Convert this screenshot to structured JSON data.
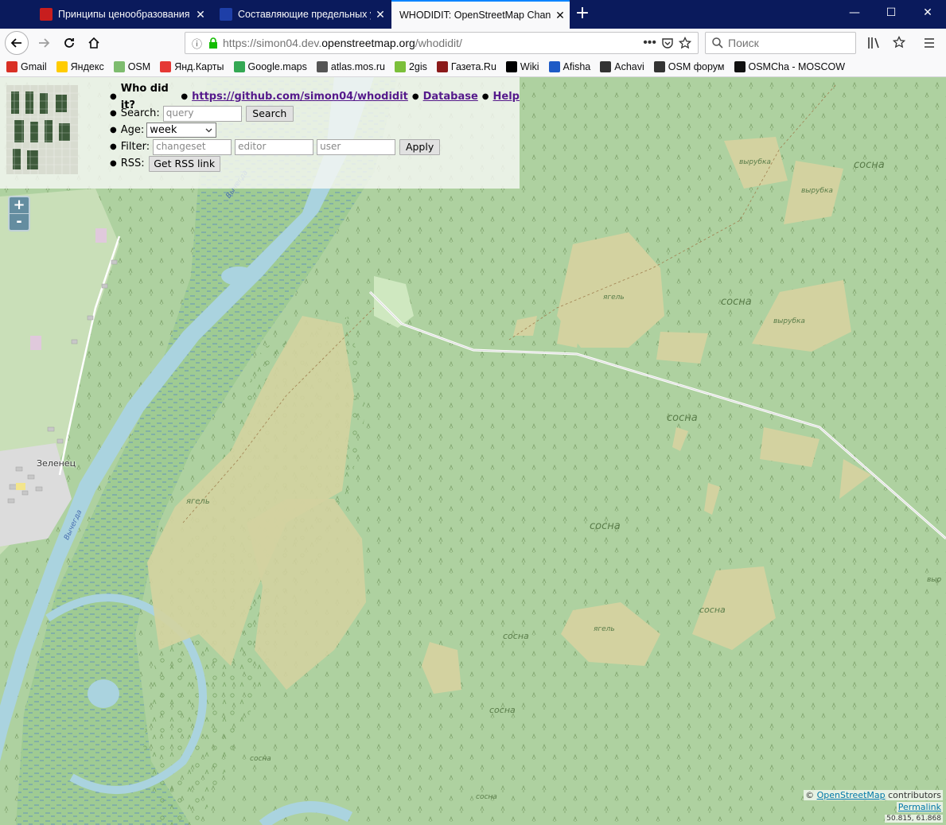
{
  "browser": {
    "tabs": [
      {
        "title": "Принципы ценообразования",
        "icon_color": "#c81e1e",
        "active": false
      },
      {
        "title": "Составляющие предельных у",
        "icon_color": "#1e3fa8",
        "active": false
      },
      {
        "title": "WHODIDIT: OpenStreetMap Chang",
        "icon_color": "#f9f9fa",
        "active": true
      }
    ],
    "new_tab_label": "+",
    "window_controls": {
      "minimize": "—",
      "maximize": "☐",
      "close": "✕"
    },
    "url": {
      "prefix": "https://simon04.dev.",
      "host": "openstreetmap.org",
      "path": "/whodidit/"
    },
    "search_placeholder": "Поиск",
    "bookmarks": [
      {
        "label": "Gmail",
        "icon": "gmail-icon",
        "color": "#d93025"
      },
      {
        "label": "Яндекс",
        "icon": "yandex-icon",
        "color": "#ffcc00"
      },
      {
        "label": "OSM",
        "icon": "osm-icon",
        "color": "#7ebc6f"
      },
      {
        "label": "Янд.Карты",
        "icon": "pin-icon",
        "color": "#e53935"
      },
      {
        "label": "Google.maps",
        "icon": "google-maps-icon",
        "color": "#34a853"
      },
      {
        "label": "atlas.mos.ru",
        "icon": "atlas-icon",
        "color": "#555555"
      },
      {
        "label": "2gis",
        "icon": "2gis-icon",
        "color": "#7bbf3a"
      },
      {
        "label": "Газета.Ru",
        "icon": "gazeta-icon",
        "color": "#8b1a1a"
      },
      {
        "label": "Wiki",
        "icon": "wiki-icon",
        "color": "#000000"
      },
      {
        "label": "Afisha",
        "icon": "afisha-icon",
        "color": "#1e5bc6"
      },
      {
        "label": "Achavi",
        "icon": "globe-icon",
        "color": "#333333"
      },
      {
        "label": "OSM форум",
        "icon": "globe-icon",
        "color": "#333333"
      },
      {
        "label": "OSMCha - MOSCOW",
        "icon": "osmcha-icon",
        "color": "#111111"
      }
    ]
  },
  "whodidit": {
    "title": "Who did it?",
    "links": [
      "https://github.com/simon04/whodidit",
      "Database",
      "Help"
    ],
    "search_label": "Search:",
    "search_placeholder": "query",
    "search_button": "Search",
    "age_label": "Age:",
    "age_value": "week",
    "filter_label": "Filter:",
    "filter_placeholders": [
      "changeset",
      "editor",
      "user"
    ],
    "apply_button": "Apply",
    "rss_label": "RSS:",
    "rss_button": "Get RSS link"
  },
  "map": {
    "zoom_in": "+",
    "zoom_out": "-",
    "labels": {
      "town": "Зеленец",
      "river_1": "Вычегда",
      "river_2": "Вычегда",
      "sosna": "сосна",
      "yagel": "ягель",
      "vyrubka": "вырубка",
      "vyr_edge": "выр"
    },
    "attribution": {
      "prefix": "© ",
      "link": "OpenStreetMap",
      "suffix": " contributors"
    },
    "permalink": "Permalink",
    "coords": "50.815, 61.868",
    "colors": {
      "forest": "#aed1a0",
      "swamp": "#d8d8a8",
      "water": "#aad3df",
      "road": "#ffffff"
    }
  }
}
